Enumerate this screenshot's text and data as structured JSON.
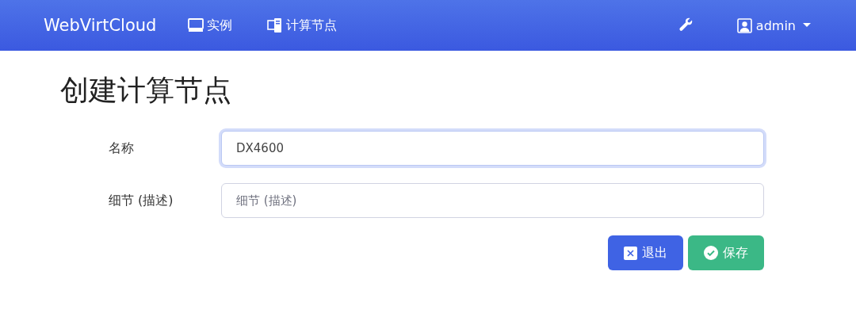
{
  "navbar": {
    "brand": "WebVirtCloud",
    "links": [
      {
        "label": "实例",
        "kind": "instances"
      },
      {
        "label": "计算节点",
        "kind": "computes"
      }
    ],
    "user": "admin"
  },
  "page": {
    "title": "创建计算节点"
  },
  "form": {
    "fields": [
      {
        "label": "名称",
        "value": "DX4600",
        "focused": true
      },
      {
        "label": "细节 (描述)",
        "placeholder": "细节 (描述)",
        "focused": false
      }
    ],
    "buttons": [
      {
        "label": "退出",
        "kind": "cancel"
      },
      {
        "label": "保存",
        "kind": "save"
      }
    ]
  }
}
